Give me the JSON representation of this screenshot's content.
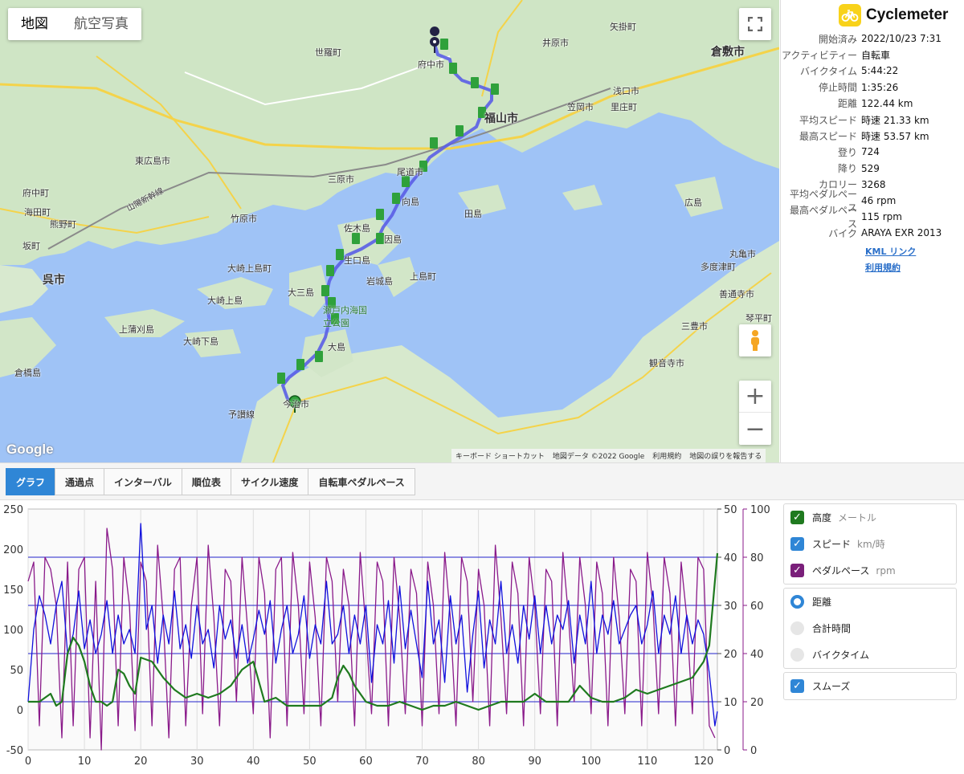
{
  "map": {
    "type_buttons": [
      "地図",
      "航空写真"
    ],
    "fullscreen_icon": "fullscreen-icon",
    "streetview_icon": "pegman-icon",
    "zoom_in": "+",
    "zoom_out": "−",
    "google_logo": "Google",
    "attribution": [
      "キーボード ショートカット",
      "地図データ ©2022 Google",
      "利用規約",
      "地図の誤りを報告する"
    ],
    "labels": [
      {
        "name": "倉敷市",
        "cls": "big"
      },
      {
        "name": "福山市",
        "cls": "big"
      },
      {
        "name": "呉市",
        "cls": "big"
      },
      {
        "name": "府中市",
        "cls": "city"
      },
      {
        "name": "井原市",
        "cls": "city"
      },
      {
        "name": "矢掛町",
        "cls": "city"
      },
      {
        "name": "世羅町",
        "cls": "city"
      },
      {
        "name": "笠岡市",
        "cls": "city"
      },
      {
        "name": "浅口市",
        "cls": "city"
      },
      {
        "name": "里庄町",
        "cls": "city"
      },
      {
        "name": "東広島市",
        "cls": "city"
      },
      {
        "name": "三原市",
        "cls": "city"
      },
      {
        "name": "尾道市",
        "cls": "city"
      },
      {
        "name": "竹原市",
        "cls": "city"
      },
      {
        "name": "府中町",
        "cls": "city"
      },
      {
        "name": "海田町",
        "cls": "city"
      },
      {
        "name": "熊野町",
        "cls": "city"
      },
      {
        "name": "坂町",
        "cls": "city"
      },
      {
        "name": "向島",
        "cls": "city"
      },
      {
        "name": "田島",
        "cls": "city"
      },
      {
        "name": "佐木島",
        "cls": "city"
      },
      {
        "name": "因島",
        "cls": "city"
      },
      {
        "name": "生口島",
        "cls": "city"
      },
      {
        "name": "岩城島",
        "cls": "city"
      },
      {
        "name": "上島町",
        "cls": "city"
      },
      {
        "name": "大崎上島町",
        "cls": "city"
      },
      {
        "name": "大三島",
        "cls": "city"
      },
      {
        "name": "大崎上島",
        "cls": "city"
      },
      {
        "name": "上蒲刈島",
        "cls": "city"
      },
      {
        "name": "大崎下島",
        "cls": "city"
      },
      {
        "name": "大島",
        "cls": "city"
      },
      {
        "name": "倉橋島",
        "cls": "city"
      },
      {
        "name": "今治市",
        "cls": "city"
      },
      {
        "name": "予讃線",
        "cls": "city"
      },
      {
        "name": "広島",
        "cls": "city"
      },
      {
        "name": "丸亀市",
        "cls": "city"
      },
      {
        "name": "多度津町",
        "cls": "city"
      },
      {
        "name": "善通寺市",
        "cls": "city"
      },
      {
        "name": "三豊市",
        "cls": "city"
      },
      {
        "name": "観音寺市",
        "cls": "city"
      },
      {
        "name": "琴平町",
        "cls": "city"
      },
      {
        "name": "瀬戸内海国立公園",
        "cls": "sea"
      },
      {
        "name": "山陽新幹線",
        "cls": "city"
      }
    ],
    "route_colors": {
      "route": "#5a5ee6",
      "marker": "#2fa13b",
      "start": "#222244"
    }
  },
  "app": {
    "name": "Cyclemeter",
    "icon": "bicycle-icon",
    "accent": "#f8d21a"
  },
  "stats": [
    {
      "label": "開始済み",
      "value": "2022/10/23 7:31"
    },
    {
      "label": "アクティビティー",
      "value": "自転車"
    },
    {
      "label": "バイクタイム",
      "value": "5:44:22"
    },
    {
      "label": "停止時間",
      "value": "1:35:26"
    },
    {
      "label": "距離",
      "value": "122.44 km"
    },
    {
      "label": "平均スピード",
      "value": "時速 21.33 km"
    },
    {
      "label": "最高スピード",
      "value": "時速 53.57 km"
    },
    {
      "label": "登り",
      "value": "724"
    },
    {
      "label": "降り",
      "value": "529"
    },
    {
      "label": "カロリー",
      "value": "3268"
    },
    {
      "label": "平均ペダルペース",
      "value": "46 rpm"
    },
    {
      "label": "最高ペダルペース",
      "value": "115 rpm"
    },
    {
      "label": "バイク",
      "value": "ARAYA EXR 2013"
    }
  ],
  "links": {
    "kml": "KML リンク",
    "terms": "利用規約"
  },
  "tabs": [
    "グラフ",
    "通過点",
    "インターバル",
    "順位表",
    "サイクル速度",
    "自転車ペダルペース"
  ],
  "legend": {
    "series": [
      {
        "label": "高度",
        "unit": "メートル",
        "color": "#1f7a1f"
      },
      {
        "label": "スピード",
        "unit": "km/時",
        "color": "#2f86d6"
      },
      {
        "label": "ペダルペース",
        "unit": "rpm",
        "color": "#7a1f7a"
      }
    ],
    "xaxis_options": [
      "距離",
      "合計時間",
      "バイクタイム"
    ],
    "smooth": "スムーズ"
  },
  "chart_data": {
    "type": "line",
    "x_ticks": [
      0,
      10,
      20,
      30,
      40,
      50,
      60,
      70,
      80,
      90,
      100,
      110,
      120
    ],
    "xlim": [
      0,
      122.44
    ],
    "y_left_ticks": [
      -50,
      0,
      50,
      100,
      150,
      200,
      250
    ],
    "y_left_lim": [
      -50,
      250
    ],
    "y_right1_ticks": [
      0,
      10,
      20,
      30,
      40,
      50
    ],
    "y_right1_lim": [
      0,
      50
    ],
    "y_right2_ticks": [
      0,
      20,
      40,
      60,
      80,
      100
    ],
    "y_right2_lim": [
      0,
      100
    ],
    "hlines_speed": [
      10,
      20,
      30,
      40
    ],
    "series": [
      {
        "name": "高度",
        "axis": "left",
        "color": "#1f7a1f",
        "x": [
          0,
          2,
          4,
          5,
          6,
          7,
          8,
          9,
          10,
          11,
          12,
          13,
          14,
          15,
          16,
          17,
          18,
          19,
          20,
          22,
          24,
          26,
          28,
          30,
          32,
          34,
          36,
          38,
          40,
          42,
          44,
          46,
          48,
          50,
          52,
          54,
          55,
          56,
          57,
          58,
          60,
          62,
          64,
          66,
          68,
          70,
          72,
          74,
          76,
          78,
          80,
          82,
          84,
          86,
          88,
          90,
          92,
          94,
          96,
          98,
          100,
          102,
          104,
          106,
          108,
          110,
          112,
          114,
          116,
          118,
          119,
          120,
          121,
          121.5,
          122,
          122.44
        ],
        "y": [
          10,
          10,
          20,
          5,
          10,
          70,
          90,
          80,
          60,
          30,
          10,
          10,
          5,
          10,
          50,
          45,
          30,
          20,
          65,
          60,
          40,
          25,
          15,
          20,
          15,
          20,
          30,
          50,
          60,
          10,
          15,
          5,
          5,
          5,
          5,
          15,
          40,
          55,
          45,
          30,
          10,
          5,
          5,
          10,
          5,
          0,
          5,
          5,
          10,
          5,
          0,
          5,
          10,
          10,
          10,
          20,
          10,
          10,
          10,
          30,
          15,
          10,
          10,
          15,
          25,
          20,
          25,
          30,
          35,
          40,
          50,
          60,
          80,
          120,
          160,
          195
        ]
      },
      {
        "name": "スピード",
        "axis": "right1",
        "color": "#1010dd",
        "x": [
          0,
          1,
          2,
          3,
          4,
          5,
          6,
          7,
          8,
          9,
          10,
          11,
          12,
          13,
          14,
          15,
          16,
          17,
          18,
          19,
          20,
          21,
          22,
          23,
          24,
          25,
          26,
          27,
          28,
          29,
          30,
          31,
          32,
          33,
          34,
          35,
          36,
          37,
          38,
          39,
          40,
          41,
          42,
          43,
          44,
          45,
          46,
          47,
          48,
          49,
          50,
          51,
          52,
          53,
          54,
          55,
          56,
          57,
          58,
          59,
          60,
          61,
          62,
          63,
          64,
          65,
          66,
          67,
          68,
          69,
          70,
          71,
          72,
          73,
          74,
          75,
          76,
          77,
          78,
          79,
          80,
          81,
          82,
          83,
          84,
          85,
          86,
          87,
          88,
          89,
          90,
          91,
          92,
          93,
          94,
          95,
          96,
          97,
          98,
          99,
          100,
          101,
          102,
          103,
          104,
          105,
          106,
          107,
          108,
          109,
          110,
          111,
          112,
          113,
          114,
          115,
          116,
          117,
          118,
          119,
          120,
          121,
          122,
          122.44
        ],
        "y": [
          10,
          25,
          32,
          28,
          22,
          30,
          35,
          20,
          24,
          33,
          21,
          27,
          20,
          24,
          31,
          20,
          28,
          22,
          25,
          20,
          47,
          25,
          30,
          18,
          28,
          22,
          33,
          21,
          26,
          19,
          30,
          22,
          25,
          17,
          30,
          23,
          27,
          19,
          26,
          18,
          23,
          29,
          24,
          31,
          18,
          25,
          30,
          20,
          24,
          32,
          19,
          26,
          22,
          35,
          22,
          24,
          30,
          20,
          28,
          22,
          30,
          14,
          26,
          22,
          31,
          18,
          34,
          21,
          29,
          22,
          15,
          35,
          22,
          27,
          14,
          32,
          22,
          28,
          12,
          24,
          33,
          17,
          27,
          22,
          35,
          20,
          26,
          18,
          30,
          23,
          32,
          20,
          30,
          22,
          28,
          25,
          31,
          18,
          28,
          22,
          35,
          20,
          28,
          24,
          31,
          22,
          25,
          28,
          30,
          22,
          26,
          33,
          20,
          28,
          24,
          32,
          20,
          28,
          22,
          27,
          24,
          16,
          5,
          8
        ]
      },
      {
        "name": "ペダルペース",
        "axis": "right2",
        "color": "#8a1a8a",
        "x": [
          0,
          1,
          2,
          3,
          4,
          5,
          6,
          7,
          8,
          9,
          10,
          11,
          12,
          13,
          14,
          15,
          16,
          17,
          18,
          19,
          20,
          21,
          22,
          23,
          24,
          25,
          26,
          27,
          28,
          29,
          30,
          31,
          32,
          33,
          34,
          35,
          36,
          37,
          38,
          39,
          40,
          41,
          42,
          43,
          44,
          45,
          46,
          47,
          48,
          49,
          50,
          51,
          52,
          53,
          54,
          55,
          56,
          57,
          58,
          59,
          60,
          61,
          62,
          63,
          64,
          65,
          66,
          67,
          68,
          69,
          70,
          71,
          72,
          73,
          74,
          75,
          76,
          77,
          78,
          79,
          80,
          81,
          82,
          83,
          84,
          85,
          86,
          87,
          88,
          89,
          90,
          91,
          92,
          93,
          94,
          95,
          96,
          97,
          98,
          99,
          100,
          101,
          102,
          103,
          104,
          105,
          106,
          107,
          108,
          109,
          110,
          111,
          112,
          113,
          114,
          115,
          116,
          117,
          118,
          119,
          120,
          121,
          122
        ],
        "y": [
          70,
          78,
          10,
          80,
          75,
          60,
          5,
          78,
          10,
          75,
          80,
          5,
          70,
          0,
          92,
          75,
          10,
          80,
          60,
          8,
          78,
          70,
          10,
          85,
          55,
          5,
          75,
          80,
          10,
          60,
          80,
          15,
          85,
          55,
          10,
          75,
          70,
          20,
          80,
          50,
          15,
          80,
          65,
          5,
          75,
          80,
          10,
          82,
          60,
          15,
          78,
          55,
          10,
          80,
          70,
          20,
          75,
          60,
          10,
          82,
          50,
          15,
          78,
          70,
          10,
          80,
          55,
          15,
          75,
          65,
          10,
          78,
          60,
          15,
          82,
          55,
          10,
          80,
          70,
          20,
          75,
          60,
          10,
          85,
          55,
          15,
          78,
          65,
          10,
          80,
          60,
          15,
          75,
          70,
          10,
          82,
          55,
          20,
          80,
          60,
          15,
          78,
          65,
          10,
          80,
          55,
          15,
          75,
          70,
          10,
          82,
          60,
          15,
          80,
          65,
          10,
          78,
          55,
          15,
          80,
          75,
          10,
          5
        ]
      }
    ]
  }
}
